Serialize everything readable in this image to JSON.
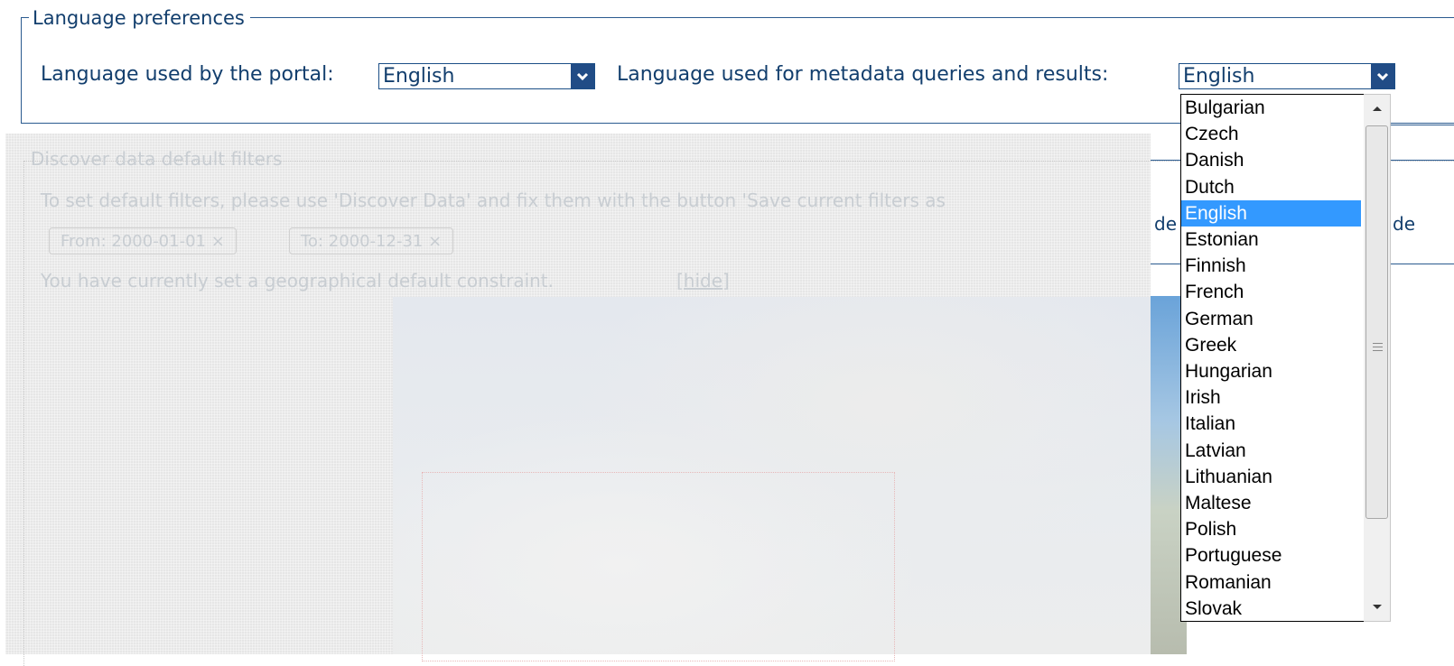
{
  "lang_prefs": {
    "legend": "Language preferences",
    "portal_label": "Language used by the portal:",
    "portal_value": "English",
    "metadata_label": "Language used for metadata queries and results:",
    "metadata_value": "English"
  },
  "discover": {
    "legend": "Discover data default filters",
    "instruction": "To set default filters, please use 'Discover Data' and fix them with the button 'Save current filters as",
    "instruction_tail_1": "de",
    "instruction_tail_2": "de",
    "filter_from": "From: 2000-01-01",
    "filter_to": "To: 2000-12-31",
    "remove_glyph": "×",
    "geo_text": "You have currently set a geographical default constraint.",
    "hide_link": "[hide]"
  },
  "dropdown": {
    "options": [
      "Bulgarian",
      "Czech",
      "Danish",
      "Dutch",
      "English",
      "Estonian",
      "Finnish",
      "French",
      "German",
      "Greek",
      "Hungarian",
      "Irish",
      "Italian",
      "Latvian",
      "Lithuanian",
      "Maltese",
      "Polish",
      "Portuguese",
      "Romanian",
      "Slovak"
    ],
    "selected": "English"
  },
  "icons": {
    "select_arrow": "chevron-down-icon",
    "scroll_up": "scroll-up-icon",
    "scroll_down": "scroll-down-icon"
  }
}
